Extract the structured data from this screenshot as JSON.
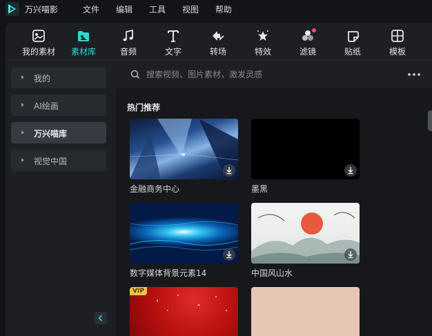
{
  "app": {
    "name": "万兴喵影"
  },
  "menu": {
    "items": [
      {
        "label": "文件"
      },
      {
        "label": "编辑"
      },
      {
        "label": "工具"
      },
      {
        "label": "视图"
      },
      {
        "label": "帮助"
      }
    ]
  },
  "toolbar": {
    "items": [
      {
        "label": "我的素材",
        "icon": "my-media-icon"
      },
      {
        "label": "素材库",
        "icon": "stock-library-icon",
        "active": true
      },
      {
        "label": "音频",
        "icon": "music-note-icon"
      },
      {
        "label": "文字",
        "icon": "text-icon"
      },
      {
        "label": "转场",
        "icon": "transition-icon"
      },
      {
        "label": "特效",
        "icon": "effects-star-icon"
      },
      {
        "label": "滤镜",
        "icon": "filter-icon",
        "has_notification": true
      },
      {
        "label": "贴纸",
        "icon": "sticker-icon"
      },
      {
        "label": "模板",
        "icon": "template-icon"
      }
    ],
    "accent_color": "#2fd7d1",
    "notification_color": "#ff4d5e"
  },
  "sidebar": {
    "items": [
      {
        "label": "我的"
      },
      {
        "label": "AI绘画"
      },
      {
        "label": "万兴喵库",
        "active": true
      },
      {
        "label": "视觉中国"
      }
    ]
  },
  "search": {
    "placeholder": "搜索视频、图片素材，激发灵感"
  },
  "main": {
    "section_title": "热门推荐",
    "cards": [
      {
        "title": "金融商务中心"
      },
      {
        "title": "墨黑"
      },
      {
        "title": "数字媒体背景元素14"
      },
      {
        "title": "中国风山水"
      },
      {
        "title": "",
        "badge": "VIP"
      },
      {
        "title": ""
      }
    ]
  }
}
